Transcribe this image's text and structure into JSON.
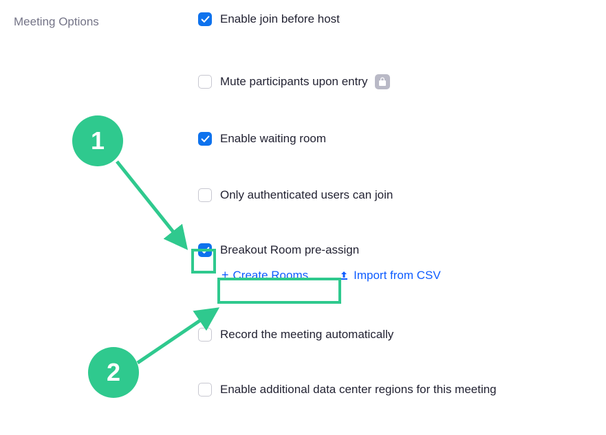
{
  "section_label": "Meeting Options",
  "options": {
    "join_before_host": {
      "label": "Enable join before host",
      "checked": true
    },
    "mute_on_entry": {
      "label": "Mute participants upon entry",
      "checked": false,
      "locked": true
    },
    "waiting_room": {
      "label": "Enable waiting room",
      "checked": true
    },
    "auth_users": {
      "label": "Only authenticated users can join",
      "checked": false
    },
    "breakout_preassign": {
      "label": "Breakout Room pre-assign",
      "checked": true
    },
    "record_auto": {
      "label": "Record the meeting automatically",
      "checked": false
    },
    "data_center": {
      "label": "Enable additional data center regions for this meeting",
      "checked": false
    }
  },
  "breakout_actions": {
    "create_rooms": "Create Rooms",
    "import_csv": "Import from CSV"
  },
  "annotations": {
    "step1": "1",
    "step2": "2"
  }
}
